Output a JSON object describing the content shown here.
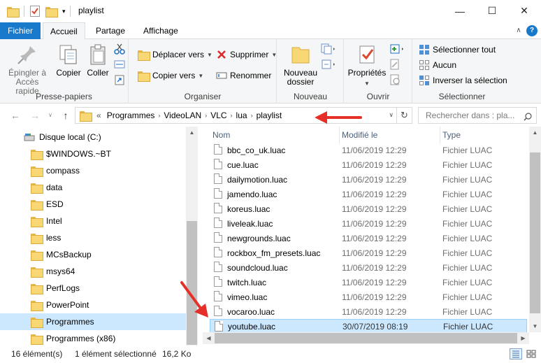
{
  "window": {
    "title": "playlist",
    "minimize_glyph": "—",
    "maximize_glyph": "☐",
    "close_glyph": "✕"
  },
  "tabs": {
    "file": "Fichier",
    "home": "Accueil",
    "share": "Partage",
    "view": "Affichage",
    "collapse_glyph": "∧",
    "help_glyph": "?"
  },
  "ribbon": {
    "clipboard": {
      "label": "Presse-papiers",
      "pin_line1": "Épingler à",
      "pin_line2": "Accès rapide",
      "copy": "Copier",
      "paste": "Coller"
    },
    "organize": {
      "label": "Organiser",
      "move_to": "Déplacer vers",
      "copy_to": "Copier vers",
      "delete": "Supprimer",
      "rename": "Renommer"
    },
    "new": {
      "label": "Nouveau",
      "new_folder_line1": "Nouveau",
      "new_folder_line2": "dossier"
    },
    "open": {
      "label": "Ouvrir",
      "properties": "Propriétés"
    },
    "select": {
      "label": "Sélectionner",
      "select_all": "Sélectionner tout",
      "select_none": "Aucun",
      "invert": "Inverser la sélection"
    }
  },
  "address": {
    "overflow": "«",
    "crumbs": [
      "Programmes",
      "VideoLAN",
      "VLC",
      "lua",
      "playlist"
    ],
    "search_placeholder": "Rechercher dans : pla..."
  },
  "nav": {
    "drive": "Disque local (C:)",
    "items": [
      "$WINDOWS.~BT",
      "compass",
      "data",
      "ESD",
      "Intel",
      "less",
      "MCsBackup",
      "msys64",
      "PerfLogs",
      "PowerPoint",
      "Programmes",
      "Programmes (x86)"
    ],
    "selected_index": 10
  },
  "columns": {
    "name": "Nom",
    "modified": "Modifié le",
    "type": "Type"
  },
  "files": [
    {
      "name": "bbc_co_uk.luac",
      "date": "11/06/2019 12:29",
      "type": "Fichier LUAC"
    },
    {
      "name": "cue.luac",
      "date": "11/06/2019 12:29",
      "type": "Fichier LUAC"
    },
    {
      "name": "dailymotion.luac",
      "date": "11/06/2019 12:29",
      "type": "Fichier LUAC"
    },
    {
      "name": "jamendo.luac",
      "date": "11/06/2019 12:29",
      "type": "Fichier LUAC"
    },
    {
      "name": "koreus.luac",
      "date": "11/06/2019 12:29",
      "type": "Fichier LUAC"
    },
    {
      "name": "liveleak.luac",
      "date": "11/06/2019 12:29",
      "type": "Fichier LUAC"
    },
    {
      "name": "newgrounds.luac",
      "date": "11/06/2019 12:29",
      "type": "Fichier LUAC"
    },
    {
      "name": "rockbox_fm_presets.luac",
      "date": "11/06/2019 12:29",
      "type": "Fichier LUAC"
    },
    {
      "name": "soundcloud.luac",
      "date": "11/06/2019 12:29",
      "type": "Fichier LUAC"
    },
    {
      "name": "twitch.luac",
      "date": "11/06/2019 12:29",
      "type": "Fichier LUAC"
    },
    {
      "name": "vimeo.luac",
      "date": "11/06/2019 12:29",
      "type": "Fichier LUAC"
    },
    {
      "name": "vocaroo.luac",
      "date": "11/06/2019 12:29",
      "type": "Fichier LUAC"
    },
    {
      "name": "youtube.luac",
      "date": "30/07/2019 08:19",
      "type": "Fichier LUAC"
    }
  ],
  "selected_file_index": 12,
  "status": {
    "count": "16 élément(s)",
    "selection": "1 élément sélectionné",
    "size": "16,2 Ko"
  },
  "colors": {
    "accent": "#1979ca",
    "selection": "#cce8ff",
    "annotation_arrow": "#e5302a"
  }
}
